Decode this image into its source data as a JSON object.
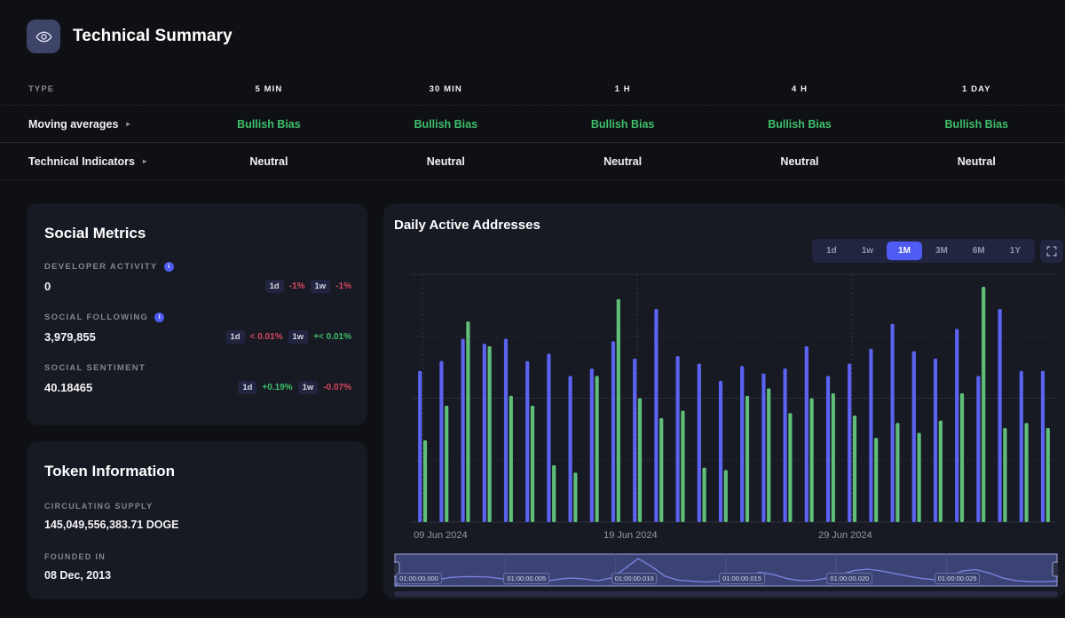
{
  "technical_summary": {
    "title": "Technical Summary",
    "badge_icon": "eye-icon",
    "columns": [
      "TYPE",
      "5 MIN",
      "30 MIN",
      "1 H",
      "4 H",
      "1 DAY"
    ],
    "rows": [
      {
        "label": "Moving averages",
        "caret": "▸",
        "values": [
          "Bullish Bias",
          "Bullish Bias",
          "Bullish Bias",
          "Bullish Bias",
          "Bullish Bias"
        ],
        "tone": "bull"
      },
      {
        "label": "Technical Indicators",
        "caret": "▸",
        "values": [
          "Neutral",
          "Neutral",
          "Neutral",
          "Neutral",
          "Neutral"
        ],
        "tone": "neutral"
      }
    ]
  },
  "social_metrics": {
    "title": "Social Metrics",
    "metrics": [
      {
        "name": "DEVELOPER ACTIVITY",
        "has_info": true,
        "info_glyph": "i",
        "value": "0",
        "chips": [
          {
            "period": "1d",
            "change": "-1%",
            "dir": "down"
          },
          {
            "period": "1w",
            "change": "-1%",
            "dir": "down"
          }
        ]
      },
      {
        "name": "SOCIAL FOLLOWING",
        "has_info": true,
        "info_glyph": "i",
        "value": "3,979,855",
        "chips": [
          {
            "period": "1d",
            "change": "< 0.01%",
            "dir": "down"
          },
          {
            "period": "1w",
            "change": "+< 0.01%",
            "dir": "up"
          }
        ]
      },
      {
        "name": "SOCIAL SENTIMENT",
        "has_info": false,
        "info_glyph": "",
        "value": "40.18465",
        "chips": [
          {
            "period": "1d",
            "change": "+0.19%",
            "dir": "up"
          },
          {
            "period": "1w",
            "change": "-0.07%",
            "dir": "down"
          }
        ]
      }
    ]
  },
  "token_information": {
    "title": "Token Information",
    "fields": [
      {
        "label": "CIRCULATING SUPPLY",
        "value": "145,049,556,383.71 DOGE"
      },
      {
        "label": "FOUNDED IN",
        "value": "08 Dec, 2013"
      }
    ]
  },
  "chart_panel": {
    "title": "Daily Active Addresses",
    "ranges": [
      {
        "label": "1d",
        "active": false
      },
      {
        "label": "1w",
        "active": false
      },
      {
        "label": "1M",
        "active": true
      },
      {
        "label": "3M",
        "active": false
      },
      {
        "label": "6M",
        "active": false
      },
      {
        "label": "1Y",
        "active": false
      }
    ],
    "fullscreen_icon": "fullscreen-icon",
    "navigator_labels": [
      "01:00:00.000",
      "01:00:00.005",
      "01:00:00.010",
      "01:00:00.015",
      "01:00:00.020",
      "01:00:00.025"
    ]
  },
  "chart_data": {
    "type": "bar",
    "title": "Daily Active Addresses",
    "xlabel": "",
    "ylabel": "",
    "grid": true,
    "legend_position": "none",
    "xlim": [
      0,
      30
    ],
    "ylim": [
      0,
      100
    ],
    "tick_labels": [
      "09 Jun 2024",
      "19 Jun 2024",
      "29 Jun 2024"
    ],
    "tick_positions": [
      0.5,
      10.5,
      20.5
    ],
    "colors": {
      "series_a": "#5b63f0",
      "series_b": "#5fbf79"
    },
    "categories": [
      "09 Jun 2024",
      "10 Jun 2024",
      "11 Jun 2024",
      "12 Jun 2024",
      "13 Jun 2024",
      "14 Jun 2024",
      "15 Jun 2024",
      "16 Jun 2024",
      "17 Jun 2024",
      "18 Jun 2024",
      "19 Jun 2024",
      "20 Jun 2024",
      "21 Jun 2024",
      "22 Jun 2024",
      "23 Jun 2024",
      "24 Jun 2024",
      "25 Jun 2024",
      "26 Jun 2024",
      "27 Jun 2024",
      "28 Jun 2024",
      "29 Jun 2024",
      "30 Jun 2024",
      "01 Jul 2024",
      "02 Jul 2024",
      "03 Jul 2024",
      "04 Jul 2024",
      "05 Jul 2024",
      "06 Jul 2024",
      "07 Jul 2024",
      "08 Jul 2024"
    ],
    "series": [
      {
        "name": "series_a",
        "color": "#5b63f0",
        "values": [
          61,
          65,
          74,
          72,
          74,
          65,
          68,
          59,
          62,
          73,
          66,
          86,
          67,
          64,
          57,
          63,
          60,
          62,
          71,
          59,
          64,
          70,
          80,
          69,
          66,
          78,
          59,
          86,
          61,
          61
        ]
      },
      {
        "name": "series_b",
        "color": "#5fbf79",
        "values": [
          33,
          47,
          81,
          71,
          51,
          47,
          23,
          20,
          59,
          90,
          50,
          42,
          45,
          22,
          21,
          51,
          54,
          44,
          50,
          52,
          43,
          34,
          40,
          36,
          41,
          52,
          95,
          38,
          40,
          38
        ]
      }
    ]
  },
  "navigator_curve": {
    "type": "area",
    "points": [
      0,
      2,
      4,
      9,
      15,
      17,
      17,
      16,
      12,
      6,
      3,
      6,
      11,
      14,
      12,
      8,
      14,
      35,
      58,
      40,
      18,
      9,
      7,
      5,
      7,
      12,
      20,
      27,
      22,
      13,
      8,
      9,
      14,
      22,
      31,
      34,
      30,
      24,
      18,
      13,
      10,
      17,
      30,
      33,
      25,
      14,
      8,
      6,
      6,
      7
    ]
  }
}
